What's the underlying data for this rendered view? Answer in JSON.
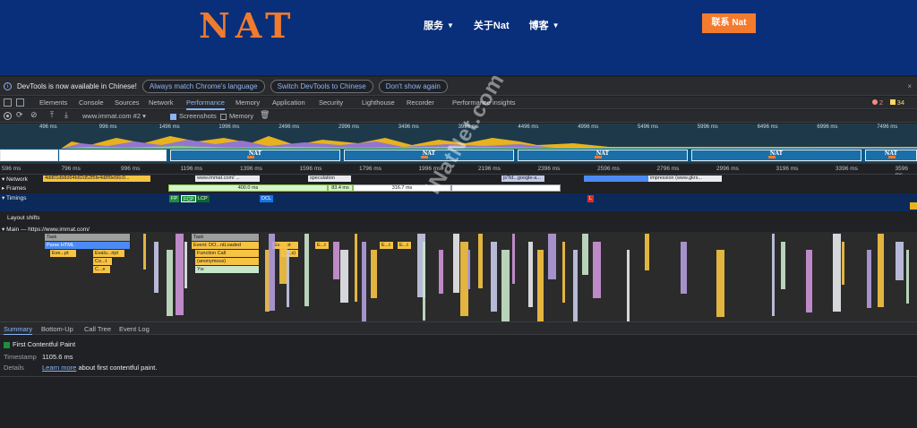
{
  "site": {
    "logo": "NAT",
    "nav": [
      "服务",
      "关于Nat",
      "博客"
    ],
    "contact": "联系 Nat"
  },
  "infobar": {
    "message": "DevTools is now available in Chinese!",
    "btn_match": "Always match Chrome's language",
    "btn_switch": "Switch DevTools to Chinese",
    "btn_dont": "Don't show again",
    "close": "×"
  },
  "tabs": [
    "Elements",
    "Console",
    "Sources",
    "Network",
    "Performance",
    "Memory",
    "Application",
    "Security",
    "Lighthouse",
    "Recorder",
    "Performance insights"
  ],
  "active_tab": "Performance",
  "badges": {
    "errors": "2",
    "warnings": "34"
  },
  "toolbar": {
    "url": "www.immat.com #2",
    "screenshots": "Screenshots",
    "memory": "Memory"
  },
  "overview_ticks": [
    "496 ms",
    "996 ms",
    "1496 ms",
    "1996 ms",
    "2496 ms",
    "2996 ms",
    "3496 ms",
    "3996 ms",
    "4496 ms",
    "4996 ms",
    "5496 ms",
    "5996 ms",
    "6496 ms",
    "6996 ms",
    "7496 ms"
  ],
  "ruler_ticks": [
    "596 ms",
    "796 ms",
    "996 ms",
    "1196 ms",
    "1396 ms",
    "1596 ms",
    "1796 ms",
    "1996 ms",
    "2196 ms",
    "2396 ms",
    "2596 ms",
    "2796 ms",
    "2996 ms",
    "3196 ms",
    "3396 ms",
    "3596 ms"
  ],
  "thumb_label": "NAT",
  "tracks": {
    "network": "Network",
    "frames": "Frames",
    "timings": "Timings",
    "layout_shifts": "Layout shifts",
    "main": "Main — https://www.immat.com/"
  },
  "network_bars": [
    {
      "label": "4dd01db8d94b82d52f5fe4d8f9e56c0..."
    },
    {
      "label": "www.immat.com/ ..."
    },
    {
      "label": "speculation"
    },
    {
      "label": "js?id...google-a..."
    },
    {
      "label": "impression (www.gkrs..."
    }
  ],
  "frames": [
    "400.0 ms",
    "83.4 ms",
    "316.7 ms"
  ],
  "timings": [
    "FP",
    "FCP",
    "LCP",
    "DCL",
    "L"
  ],
  "flames": {
    "task": "Task",
    "parse_html": "Parse HTML",
    "eve_pt": "Eve...pt",
    "evalu_ript": "Evalu...ript",
    "co_t": "Co...t",
    "c_e": "C...e",
    "event_dcl": "Event: DO...ntLoaded",
    "function_call": "Function Call",
    "anonymous": "(anonymous)",
    "yw": "Yw",
    "eve_dot": "Eve...pt",
    "a_c": "(a...s)",
    "e_t": "E...t"
  },
  "watermark": "iNatNet.com",
  "bottom_tabs": [
    "Summary",
    "Bottom-Up",
    "Call Tree",
    "Event Log"
  ],
  "summary": {
    "title": "First Contentful Paint",
    "timestamp_label": "Timestamp",
    "timestamp_value": "1105.6 ms",
    "details_label": "Details",
    "learn_more": "Learn more",
    "details_rest": " about first contentful paint."
  }
}
